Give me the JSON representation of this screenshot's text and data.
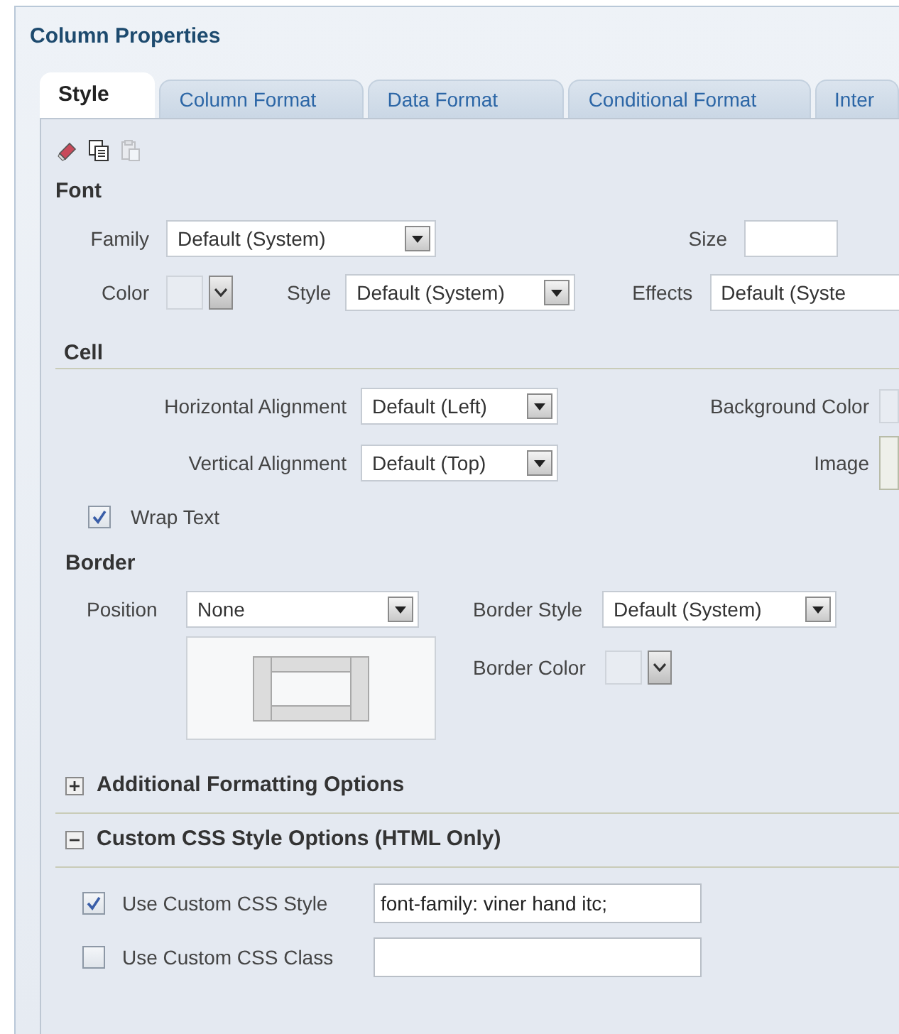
{
  "panel_title": "Column Properties",
  "tabs": [
    {
      "label": "Style",
      "selected": true
    },
    {
      "label": "Column Format",
      "selected": false
    },
    {
      "label": "Data Format",
      "selected": false
    },
    {
      "label": "Conditional Format",
      "selected": false
    },
    {
      "label": "Inter",
      "selected": false
    }
  ],
  "toolbar": [
    {
      "kind": "eraser",
      "disabled": false
    },
    {
      "kind": "copy",
      "disabled": false
    },
    {
      "kind": "paste",
      "disabled": true
    }
  ],
  "font": {
    "heading": "Font",
    "family": {
      "label": "Family",
      "value": "Default (System)"
    },
    "size": {
      "label": "Size"
    },
    "color": {
      "label": "Color"
    },
    "style": {
      "label": "Style",
      "value": "Default (System)"
    },
    "effects": {
      "label": "Effects",
      "value": "Default (Syste"
    }
  },
  "cell": {
    "heading": "Cell",
    "horizontal_alignment": {
      "label": "Horizontal Alignment",
      "value": "Default (Left)"
    },
    "background_color": {
      "label": "Background Color"
    },
    "vertical_alignment": {
      "label": "Vertical Alignment",
      "value": "Default (Top)"
    },
    "image": {
      "label": "Image"
    },
    "wrap_text": {
      "label": "Wrap Text",
      "checked": true
    }
  },
  "border": {
    "heading": "Border",
    "position": {
      "label": "Position",
      "value": "None"
    },
    "border_style": {
      "label": "Border Style",
      "value": "Default (System)"
    },
    "border_color": {
      "label": "Border Color"
    }
  },
  "sections": [
    {
      "title": "Additional Formatting Options",
      "expanded": false
    },
    {
      "title": "Custom CSS Style Options (HTML Only)",
      "expanded": true
    }
  ],
  "custom_css": [
    {
      "label": "Use Custom CSS Style",
      "checked": true,
      "value": "font-family: viner hand itc;"
    },
    {
      "label": "Use Custom CSS Class",
      "checked": false
    }
  ]
}
